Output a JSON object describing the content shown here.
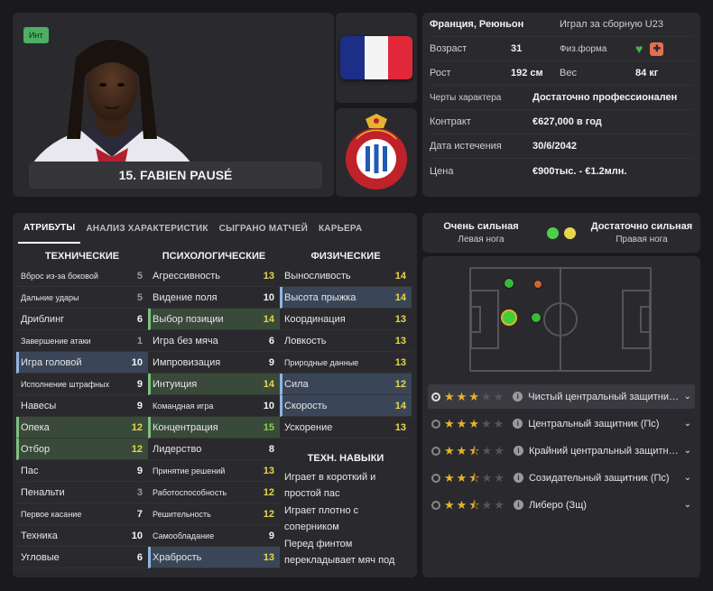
{
  "player": {
    "badge": "Инт",
    "name": "15. FABIEN PAUSÉ"
  },
  "info": {
    "nationality": "Франция, Реюньон",
    "intl": "Играл за сборную U23",
    "age_label": "Возраст",
    "age": "31",
    "fitness_label": "Физ.форма",
    "height_label": "Рост",
    "height": "192 см",
    "weight_label": "Вес",
    "weight": "84 кг",
    "personality_label": "Черты характера",
    "personality": "Достаточно профессионален",
    "contract_label": "Контракт",
    "contract": "€627,000 в год",
    "expiry_label": "Дата истечения",
    "expiry": "30/6/2042",
    "value_label": "Цена",
    "value": "€900тыс. - €1.2млн."
  },
  "tabs": [
    "АТРИБУТЫ",
    "АНАЛИЗ ХАРАКТЕРИСТИК",
    "СЫГРАНО МАТЧЕЙ",
    "КАРЬЕРА"
  ],
  "technical": {
    "title": "ТЕХНИЧЕСКИЕ",
    "items": [
      {
        "name": "Вброс из-за боковой",
        "value": "5"
      },
      {
        "name": "Дальние удары",
        "value": "5"
      },
      {
        "name": "Дриблинг",
        "value": "6"
      },
      {
        "name": "Завершение атаки",
        "value": "1"
      },
      {
        "name": "Игра головой",
        "value": "10"
      },
      {
        "name": "Исполнение штрафных",
        "value": "9"
      },
      {
        "name": "Навесы",
        "value": "9"
      },
      {
        "name": "Опека",
        "value": "12"
      },
      {
        "name": "Отбор",
        "value": "12"
      },
      {
        "name": "Пас",
        "value": "9"
      },
      {
        "name": "Пенальти",
        "value": "3"
      },
      {
        "name": "Первое касание",
        "value": "7"
      },
      {
        "name": "Техника",
        "value": "10"
      },
      {
        "name": "Угловые",
        "value": "6"
      }
    ]
  },
  "mental": {
    "title": "ПСИХОЛОГИЧЕСКИЕ",
    "items": [
      {
        "name": "Агрессивность",
        "value": "13"
      },
      {
        "name": "Видение поля",
        "value": "10"
      },
      {
        "name": "Выбор позиции",
        "value": "14"
      },
      {
        "name": "Игра без мяча",
        "value": "6"
      },
      {
        "name": "Импровизация",
        "value": "9"
      },
      {
        "name": "Интуиция",
        "value": "14"
      },
      {
        "name": "Командная игра",
        "value": "10"
      },
      {
        "name": "Концентрация",
        "value": "15"
      },
      {
        "name": "Лидерство",
        "value": "8"
      },
      {
        "name": "Принятие решений",
        "value": "13"
      },
      {
        "name": "Работоспособность",
        "value": "12"
      },
      {
        "name": "Решительность",
        "value": "12"
      },
      {
        "name": "Самообладание",
        "value": "9"
      },
      {
        "name": "Храбрость",
        "value": "13"
      }
    ]
  },
  "physical": {
    "title": "ФИЗИЧЕСКИЕ",
    "items": [
      {
        "name": "Выносливость",
        "value": "14"
      },
      {
        "name": "Высота прыжка",
        "value": "14"
      },
      {
        "name": "Координация",
        "value": "13"
      },
      {
        "name": "Ловкость",
        "value": "13"
      },
      {
        "name": "Природные данные",
        "value": "13"
      },
      {
        "name": "Сила",
        "value": "12"
      },
      {
        "name": "Скорость",
        "value": "14"
      },
      {
        "name": "Ускорение",
        "value": "13"
      }
    ]
  },
  "skills": {
    "title": "ТЕХН. НАВЫКИ",
    "items": [
      "Играет в короткий и простой пас",
      "Играет плотно с соперником",
      "Перед финтом перекладывает мяч под"
    ]
  },
  "foot": {
    "left_strength": "Очень сильная",
    "left_label": "Левая нога",
    "right_strength": "Достаточно сильная",
    "right_label": "Правая нога"
  },
  "roles": [
    {
      "name": "Чистый центральный защитник (Ст)",
      "stars": 3,
      "selected": true
    },
    {
      "name": "Центральный защитник (Пс)",
      "stars": 3,
      "selected": false
    },
    {
      "name": "Крайний центральный защитник (Пс)",
      "stars": 2.5,
      "selected": false
    },
    {
      "name": "Созидательный защитник (Пс)",
      "stars": 2.5,
      "selected": false
    },
    {
      "name": "Либеро (Зщ)",
      "stars": 2.5,
      "selected": false
    }
  ],
  "colors": {
    "green": "#4caf50",
    "yellow": "#e6d84a",
    "orange": "#c9672b",
    "accent_green": "#7ec07e",
    "accent_blue": "#8fb5e0"
  }
}
